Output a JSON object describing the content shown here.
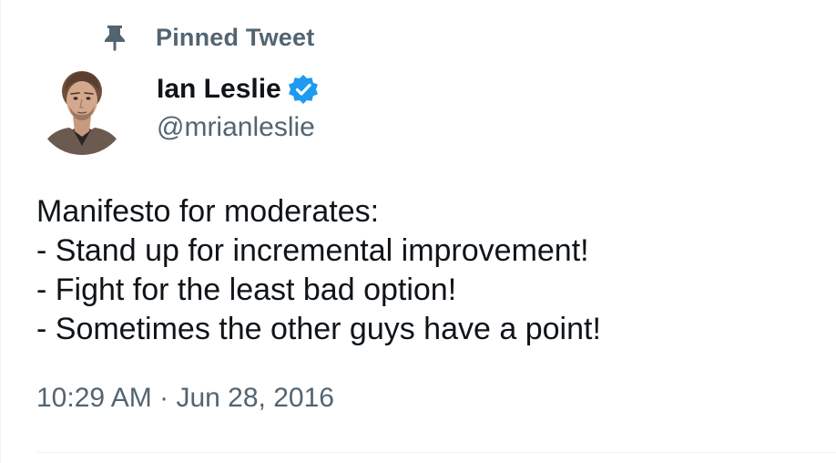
{
  "pinned": {
    "icon": "pin-icon",
    "label": "Pinned Tweet"
  },
  "author": {
    "avatar_icon": "avatar",
    "display_name": "Ian Leslie",
    "verified_icon": "verified-badge-icon",
    "verified_color": "#1d9bf0",
    "handle": "@mrianleslie"
  },
  "tweet": {
    "lines": [
      "Manifesto for moderates:",
      "- Stand up for incremental improvement!",
      "- Fight for the least bad option!",
      "- Sometimes the other guys have a point!"
    ],
    "time": "10:29 AM",
    "separator": "·",
    "date": "Jun 28, 2016"
  },
  "colors": {
    "primary_text": "#0f1419",
    "secondary_text": "#536471",
    "accent": "#1d9bf0",
    "divider": "#eff3f4"
  }
}
